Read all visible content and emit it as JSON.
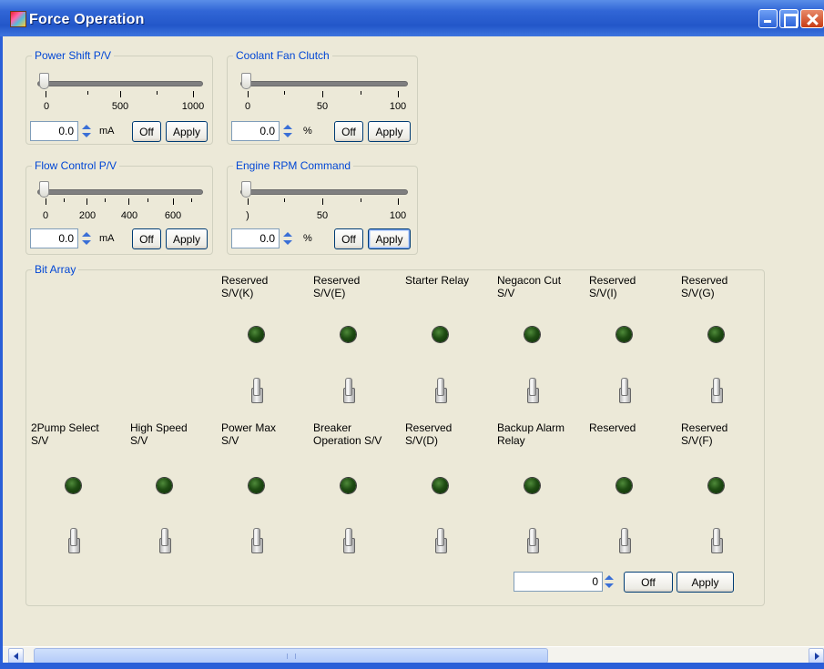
{
  "window": {
    "title": "Force Operation"
  },
  "groups": {
    "power_shift": {
      "title": "Power Shift P/V",
      "ticks": [
        "0",
        "500",
        "1000"
      ],
      "value": "0.0",
      "unit": "mA",
      "off_label": "Off",
      "apply_label": "Apply"
    },
    "coolant_fan": {
      "title": "Coolant Fan Clutch",
      "ticks": [
        "0",
        "50",
        "100"
      ],
      "value": "0.0",
      "unit": "%",
      "off_label": "Off",
      "apply_label": "Apply"
    },
    "flow_control": {
      "title": "Flow Control P/V",
      "ticks": [
        "0",
        "200",
        "400",
        "600"
      ],
      "value": "0.0",
      "unit": "mA",
      "off_label": "Off",
      "apply_label": "Apply"
    },
    "engine_rpm": {
      "title": "Engine RPM Command",
      "ticks": [
        ")",
        "50",
        "100"
      ],
      "value": "0.0",
      "unit": "%",
      "off_label": "Off",
      "apply_label": "Apply"
    }
  },
  "bit_array": {
    "title": "Bit Array",
    "row1": [
      "Reserved\nS/V(K)",
      "Reserved\nS/V(E)",
      "Starter Relay",
      "Negacon Cut\nS/V",
      "Reserved\nS/V(I)",
      "Reserved\nS/V(G)"
    ],
    "row2": [
      "2Pump Select\nS/V",
      "High Speed\nS/V",
      "Power Max\nS/V",
      "Breaker\nOperation S/V",
      "Reserved\nS/V(D)",
      "Backup Alarm\nRelay",
      "Reserved",
      "Reserved\nS/V(F)"
    ],
    "value": "0",
    "off_label": "Off",
    "apply_label": "Apply"
  },
  "colors": {
    "legend": "#0046d5",
    "led_off": "#1f4d13",
    "titlebar": "#2357c9"
  }
}
